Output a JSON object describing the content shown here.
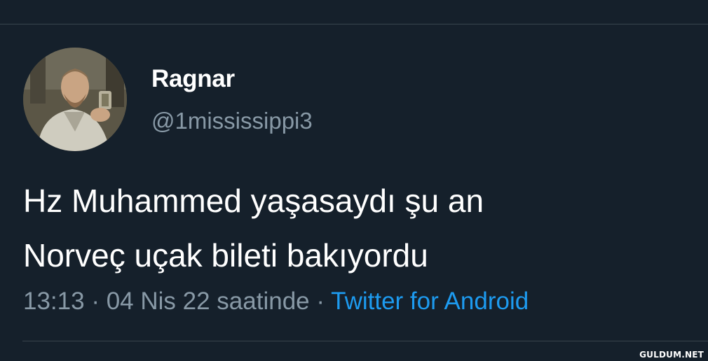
{
  "tweet": {
    "display_name": "Ragnar",
    "handle": "@1mississippi3",
    "text_lines": [
      "Hz Muhammed yaşasaydı şu an",
      "Norveç uçak bileti bakıyordu"
    ],
    "time": "13:13",
    "separator": "·",
    "date": "04 Nis 22 saatinde",
    "source": "Twitter for Android"
  },
  "watermark": "GULDUM.NET",
  "colors": {
    "background": "#15202b",
    "secondary_text": "#8899a6",
    "link": "#1d9bf0",
    "divider": "#38444d"
  }
}
